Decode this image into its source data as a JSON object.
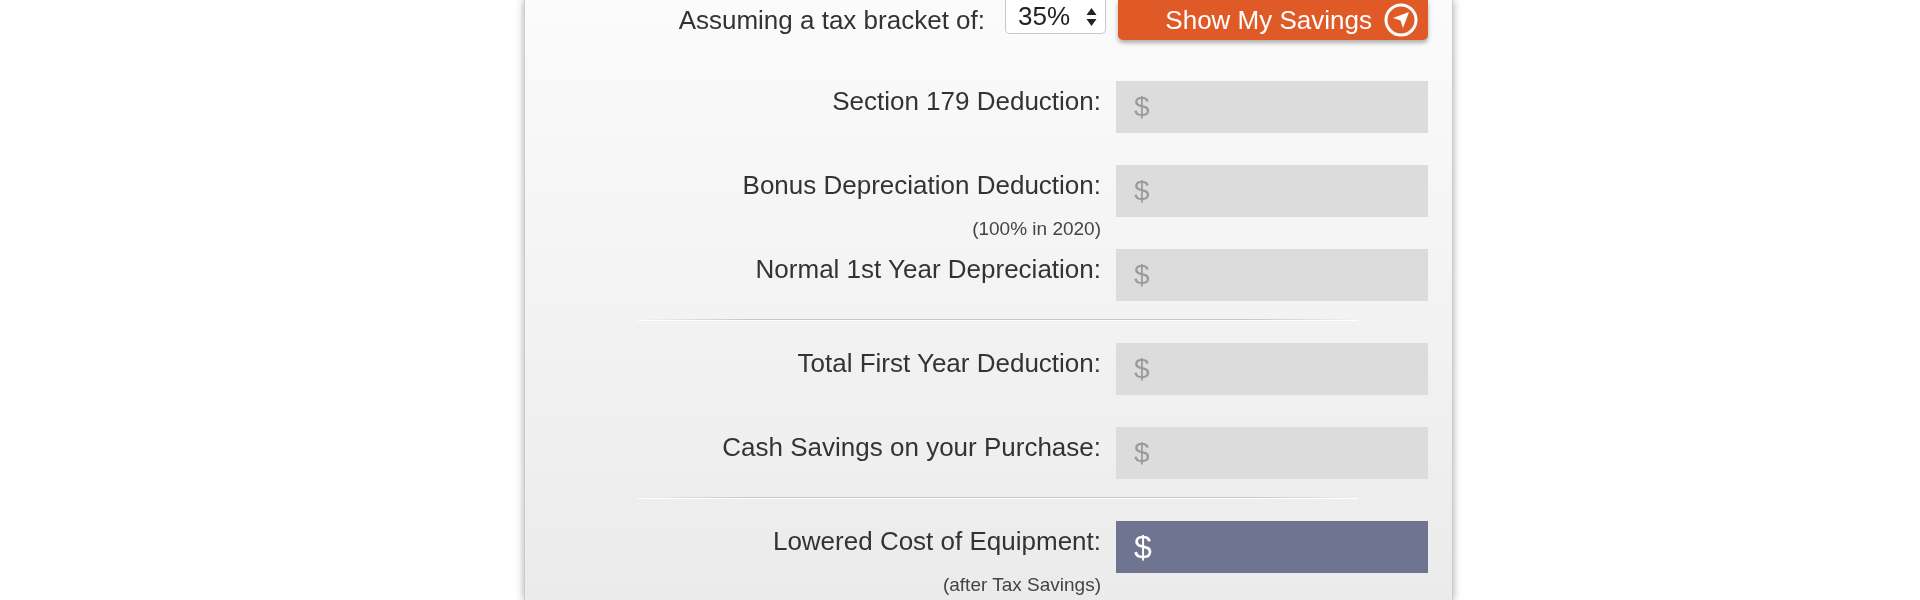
{
  "tax_bracket": {
    "label": "Assuming a tax bracket of:",
    "value": "35%"
  },
  "show_savings_button": {
    "label": "Show My Savings"
  },
  "sections": [
    {
      "rows": [
        {
          "label": "Section 179 Deduction:",
          "prefix": "$",
          "kind": "plain"
        },
        {
          "label": "Bonus Depreciation Deduction:",
          "note": "(100% in 2020)",
          "prefix": "$",
          "kind": "plain"
        },
        {
          "label": "Normal 1st Year Depreciation:",
          "prefix": "$",
          "kind": "plain"
        }
      ]
    },
    {
      "rows": [
        {
          "label": "Total First Year Deduction:",
          "prefix": "$",
          "kind": "plain"
        },
        {
          "label": "Cash Savings on your Purchase:",
          "prefix": "$",
          "kind": "plain"
        }
      ]
    },
    {
      "rows": [
        {
          "label": "Lowered Cost of Equipment:",
          "note": "(after Tax Savings)",
          "prefix": "$",
          "kind": "total"
        }
      ]
    }
  ]
}
